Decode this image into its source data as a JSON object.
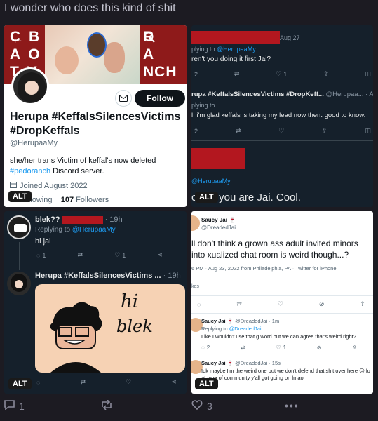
{
  "post": {
    "text": "I wonder who does this kind of shit"
  },
  "alt_label": "ALT",
  "profile": {
    "banner_left_letters": "C B A O T V",
    "banner_right_letters": "R A NCH",
    "banner_left_line1": "C B",
    "banner_left_line2": "A O",
    "banner_left_line3": "T V",
    "banner_right_line1": "R",
    "banner_right_line2": "A",
    "banner_right_line3": "NCH",
    "follow_label": "Follow",
    "name": "Herupa #KeffalsSilencesVictims #DropKeffals",
    "handle": "@HerupaaMy",
    "bio_line1": "she/her  trans  Victim of keffal's now deleted",
    "bio_link": "#pedoranch",
    "bio_rest": " Discord server.",
    "joined": "Joined August 2022",
    "following_count": "",
    "following_label": "Following",
    "followers_count": "107",
    "followers_label": "Followers"
  },
  "tile2": {
    "t1_date": "Aug 27",
    "t1_reply_prefix": "plying to ",
    "t1_reply_handle": "@HerupaaMy",
    "t1_text": "ren't you doing it first Jai?",
    "t1_replies": "2",
    "t1_likes": "1",
    "t2_name": "rupa #KeffalsSilencesVictims #DropKeff...",
    "t2_handle": "@Herupaa... · A",
    "t2_reply_prefix": "plying to",
    "t2_text": "l, i'm glad keffals is taking my lead now then. good to know.",
    "t2_replies": "2",
    "t3_handle": "@HerupaaMy",
    "t3_text": "claim you are Jai. Cool."
  },
  "tile3": {
    "r1_name": "blek??",
    "r1_time": "· 19h",
    "r1_reply_prefix": "Replying to ",
    "r1_reply_handle": "@HerupaaMy",
    "r1_text": "hi jai",
    "r1_replies": "1",
    "r1_likes": "1",
    "r2_name": "Herupa #KeffalsSilencesVictims ...",
    "r2_time": "· 19h",
    "drawing_text_1": "hi",
    "drawing_text_2": "blek"
  },
  "tile4": {
    "m_name": "Saucy Jai",
    "m_handle": "@DreadedJai",
    "m_text": "ll don't think a grown ass adult invited minors into xualized chat room is weird though...?",
    "m_meta": "6 PM · Aug 23, 2022 from Philadelphia, PA · Twitter for iPhone",
    "m_likes_label": "kes",
    "r1_name": "Saucy Jai",
    "r1_handle": "@DreadedJai · 1m",
    "r1_reply_prefix": "Replying to ",
    "r1_reply_handle": "@DreadedJai",
    "r1_text": "Like I wouldn't use that g word but we can agree that's weird right?",
    "r1_replies": "2",
    "r1_likes": "1",
    "r2_name": "Saucy Jai",
    "r2_handle": "@DreadedJai · 15s",
    "r2_text": "Idk maybe I'm the weird one but we don't defend that shit over here 😕 lo at type of community y'all got going on lmao"
  },
  "bottom": {
    "replies": "1",
    "likes": "3"
  }
}
